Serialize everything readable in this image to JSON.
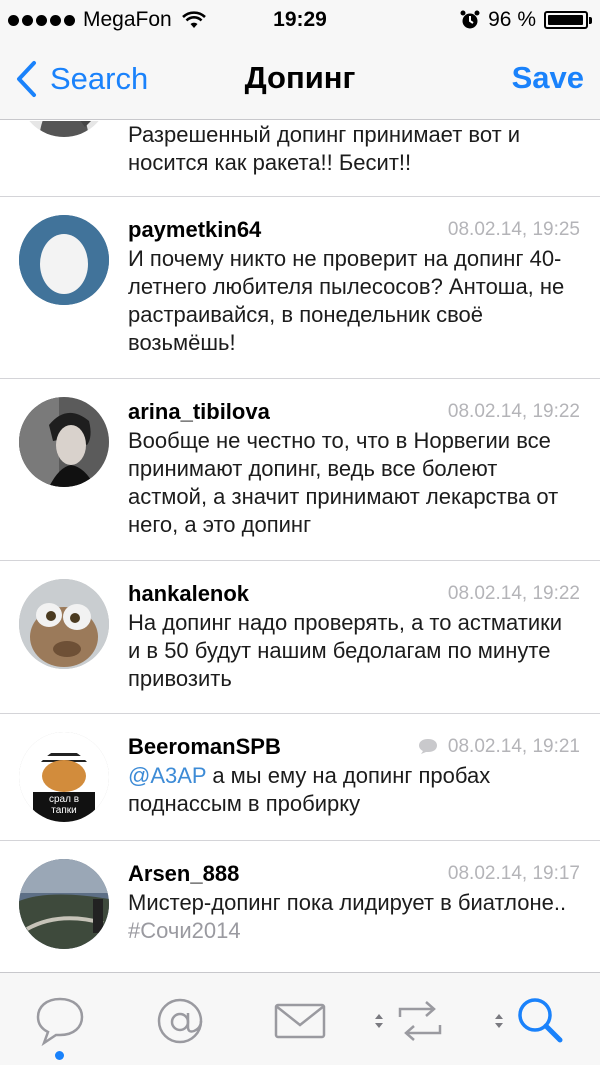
{
  "status_bar": {
    "carrier": "MegaFon",
    "time": "19:29",
    "battery": "96 %",
    "battery_level": 0.96
  },
  "nav": {
    "back_label": "Search",
    "title": "Допинг",
    "save_label": "Save"
  },
  "tweets": [
    {
      "username": "",
      "timestamp": "",
      "text": "Разрешенный допинг принимает вот и носится как ракета!! Бесит!!"
    },
    {
      "username": "paymetkin64",
      "timestamp": "08.02.14, 19:25",
      "text": "И почему никто не проверит на допинг 40-летнего любителя пылесосов? Антоша, не растраивайся, в понедельник своё возьмёшь!"
    },
    {
      "username": "arina_tibilova",
      "timestamp": "08.02.14, 19:22",
      "text": "Вообще не честно то, что в Норвегии все принимают допинг, ведь все болеют астмой, а значит принимают лекарства от него, а это допинг"
    },
    {
      "username": "hankalenok",
      "timestamp": "08.02.14, 19:22",
      "text": "На допинг надо проверять, а то астматики и в 50 будут нашим бедолагам по минуте привозить"
    },
    {
      "username": "BeeromanSPB",
      "timestamp": "08.02.14, 19:21",
      "mention": "@A3AP",
      "text": " а мы ему на допинг пробах поднассым в пробирку",
      "avatar_caption": "срал в тапки"
    },
    {
      "username": "Arsen_888",
      "timestamp": "08.02.14, 19:17",
      "text": "Мистер-допинг пока лидирует в биатлоне.. ",
      "hashtag": "#Сочи2014"
    }
  ],
  "tab_bar": {
    "active_tab": "timeline",
    "tabs": [
      "timeline-icon",
      "mentions-icon",
      "messages-icon",
      "retweets-icon",
      "search-icon"
    ]
  },
  "colors": {
    "accent": "#1a82fb",
    "mention": "#3d8bd6",
    "timestamp": "#b4b4b8"
  }
}
